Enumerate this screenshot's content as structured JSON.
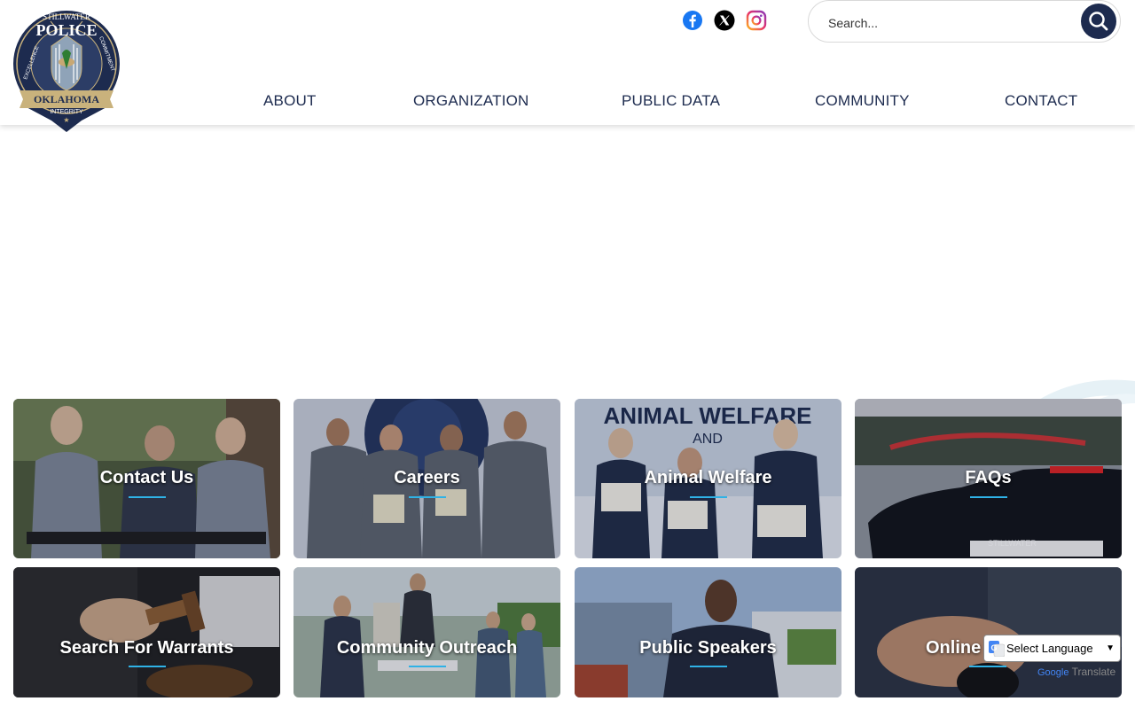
{
  "header": {
    "logo": {
      "top_text": "STILLWATER",
      "main_text": "POLICE",
      "left_text": "EXCELLENCE",
      "right_text": "COMMITMENT",
      "banner_text": "OKLAHOMA",
      "bottom_text": "INTEGRITY"
    },
    "social": [
      {
        "name": "facebook-icon",
        "color": "#1877f2"
      },
      {
        "name": "x-icon",
        "color": "#000000"
      },
      {
        "name": "instagram-icon",
        "color": "#d6249f"
      }
    ],
    "search": {
      "placeholder": "Search..."
    },
    "nav": [
      "ABOUT",
      "ORGANIZATION",
      "PUBLIC DATA",
      "COMMUNITY",
      "CONTACT"
    ]
  },
  "tiles": [
    {
      "label": "Contact Us"
    },
    {
      "label": "Careers"
    },
    {
      "label": "Animal Welfare"
    },
    {
      "label": "FAQs"
    },
    {
      "label": "Search For Warrants"
    },
    {
      "label": "Community Outreach"
    },
    {
      "label": "Public Speakers"
    },
    {
      "label": "Online T"
    }
  ],
  "translate": {
    "select_label": "Select Language",
    "powered_by": "Google",
    "powered_suffix": "Translate"
  },
  "colors": {
    "brand_navy": "#1d2b4f",
    "accent_blue": "#2fb2e6"
  }
}
